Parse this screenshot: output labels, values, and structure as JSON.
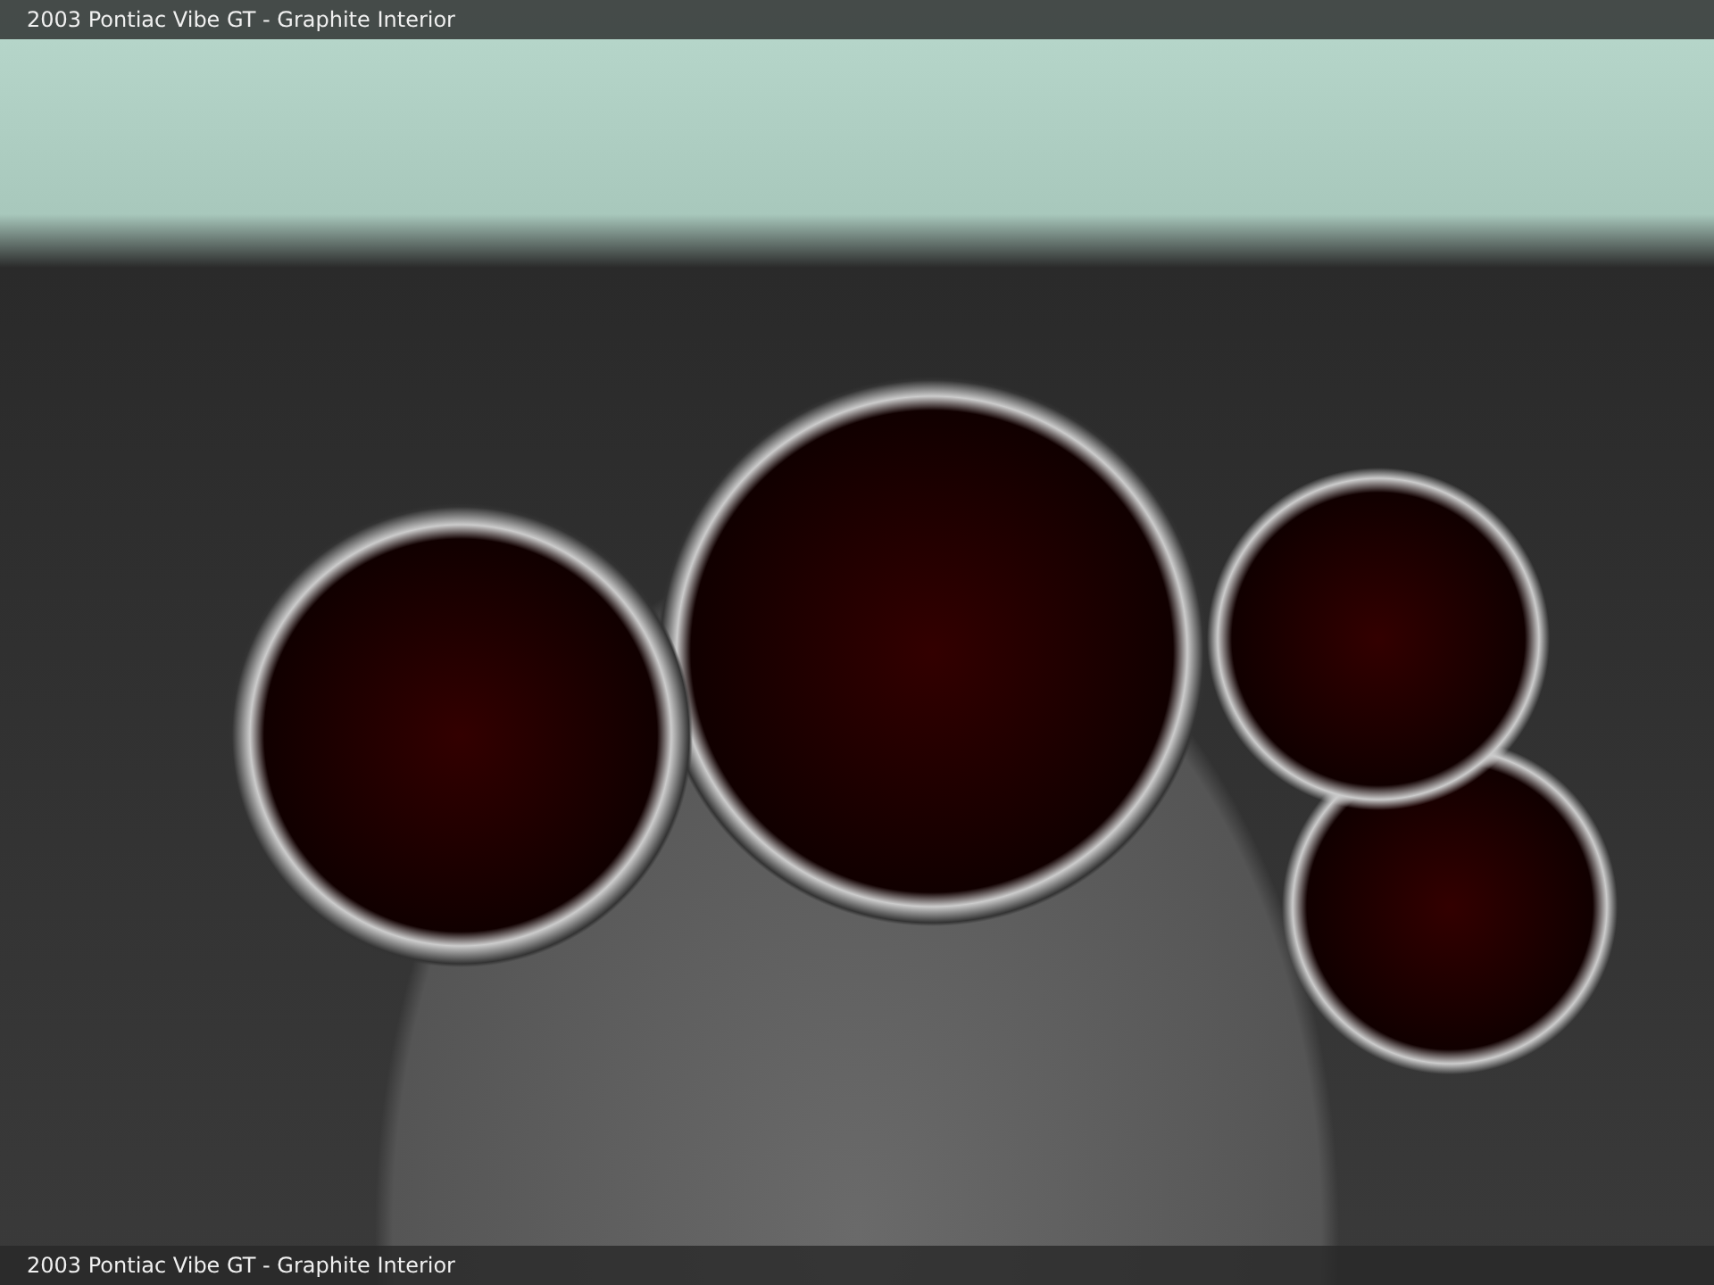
{
  "header": {
    "title": "2003 Pontiac Vibe GT - Graphite Interior"
  },
  "footer": {
    "caption": "2003 Pontiac Vibe GT - Graphite Interior"
  }
}
